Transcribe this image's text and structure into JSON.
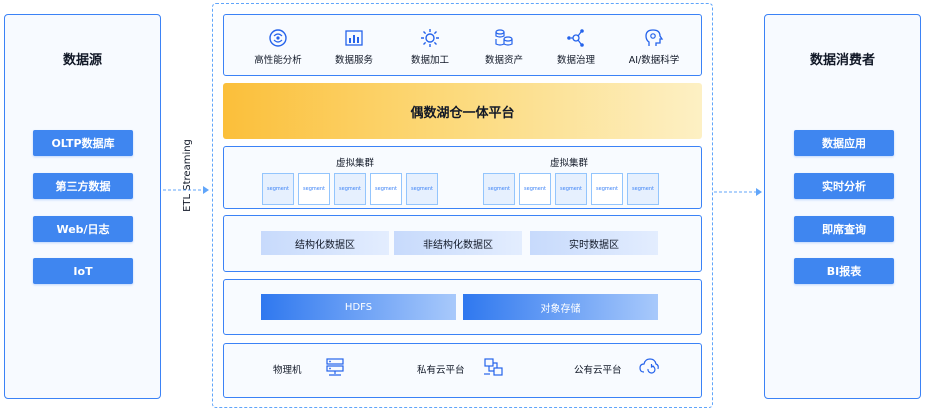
{
  "sources": {
    "title": "数据源",
    "items": [
      "OLTP数据库",
      "第三方数据",
      "Web/日志",
      "IoT"
    ]
  },
  "etl_label": "ETL  Streaming",
  "tools": [
    {
      "icon": "brain-cycle-icon",
      "label": "高性能分析"
    },
    {
      "icon": "bar-chart-icon",
      "label": "数据服务"
    },
    {
      "icon": "gear-process-icon",
      "label": "数据加工"
    },
    {
      "icon": "database-stack-icon",
      "label": "数据资产"
    },
    {
      "icon": "network-nodes-icon",
      "label": "数据治理"
    },
    {
      "icon": "ai-head-icon",
      "label": "AI/数据科学"
    }
  ],
  "platform_title": "偶数湖仓一体平台",
  "clusters": [
    {
      "title": "虚拟集群",
      "segments": [
        "segment",
        "segment",
        "segment",
        "segment",
        "segment"
      ]
    },
    {
      "title": "虚拟集群",
      "segments": [
        "segment",
        "segment",
        "segment",
        "segment",
        "segment"
      ]
    }
  ],
  "zones": [
    "结构化数据区",
    "非结构化数据区",
    "实时数据区"
  ],
  "storage": [
    "HDFS",
    "对象存储"
  ],
  "infra": [
    {
      "label": "物理机",
      "icon": "server-icon"
    },
    {
      "label": "私有云平台",
      "icon": "private-cloud-icon"
    },
    {
      "label": "公有云平台",
      "icon": "public-cloud-icon"
    }
  ],
  "consumers": {
    "title": "数据消费者",
    "items": [
      "数据应用",
      "实时分析",
      "即席查询",
      "BI报表"
    ]
  },
  "colors": {
    "accent": "#3f86f0",
    "platform_gold": "#fbbf3a",
    "border": "#3b82f6"
  }
}
